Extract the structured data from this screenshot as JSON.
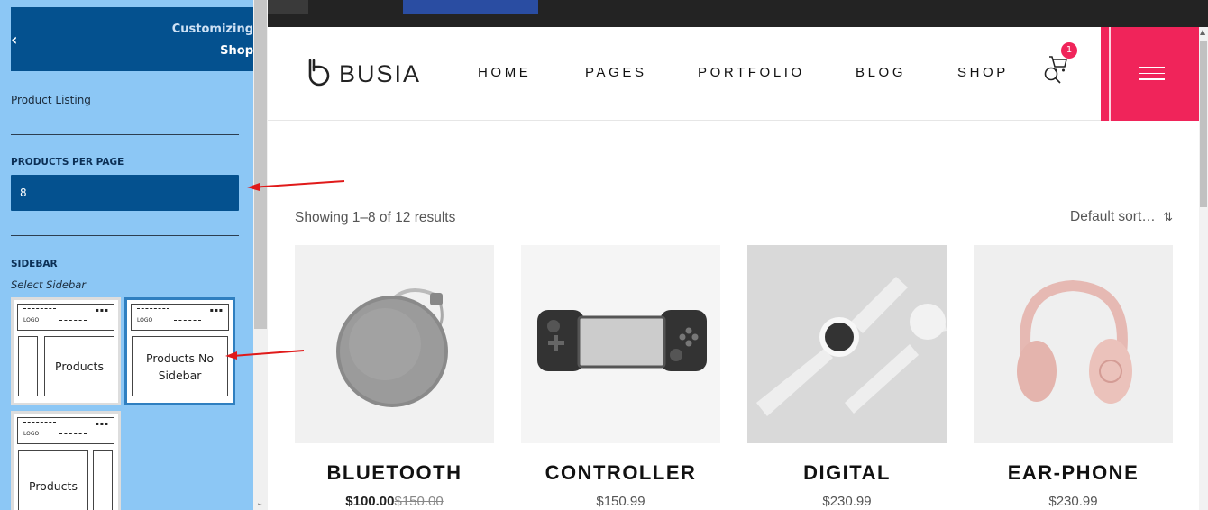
{
  "customizer": {
    "title_line1": "Customizing",
    "title_line2": "Shop",
    "section": "Product Listing",
    "products_per_page_label": "PRODUCTS PER PAGE",
    "products_per_page_value": "8",
    "sidebar_label": "SIDEBAR",
    "sidebar_sub": "Select Sidebar",
    "layouts": [
      {
        "text": "Products",
        "selected": false
      },
      {
        "text": "Products No Sidebar",
        "selected": true
      },
      {
        "text": "Products",
        "selected": false
      }
    ],
    "thumb_logo": "LOGO"
  },
  "site": {
    "logo_text": "BUSIA",
    "nav": [
      "HOME",
      "PAGES",
      "PORTFOLIO",
      "BLOG",
      "SHOP"
    ],
    "cart_count": "1",
    "accent": "#f0245a"
  },
  "shop": {
    "showing": "Showing 1–8 of 12 results",
    "sort": "Default sort…",
    "products": [
      {
        "name": "BLUETOOTH",
        "price": "$100.00",
        "old_price": "$150.00"
      },
      {
        "name": "CONTROLLER",
        "price": "$150.99",
        "old_price": ""
      },
      {
        "name": "DIGITAL",
        "price": "$230.99",
        "old_price": ""
      },
      {
        "name": "EAR-PHONE",
        "price": "$230.99",
        "old_price": ""
      }
    ]
  }
}
